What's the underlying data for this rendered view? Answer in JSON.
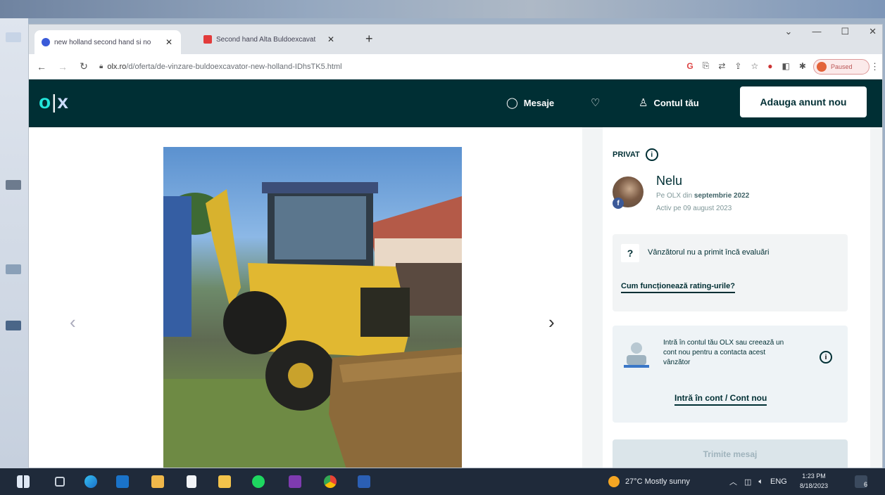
{
  "browser": {
    "tabs": [
      {
        "title": "new holland second hand si no",
        "favicon_color": "#3a5bd9",
        "active": true
      },
      {
        "title": "Second hand Alta Buldoexcavat",
        "favicon_color": "#e23b3b",
        "active": false
      }
    ],
    "new_tab": "+",
    "url_host": "olx.ro",
    "url_path": "/d/oferta/de-vinzare-buldoexcavator-new-holland-IDhsTK5.html",
    "profile_status": "Paused",
    "window_controls": [
      "⌄",
      "—",
      "☐",
      "✕"
    ]
  },
  "header": {
    "logo": {
      "o": "o",
      "bar": "|",
      "x": "x"
    },
    "messages_label": "Mesaje",
    "account_label": "Contul tău",
    "post_button": "Adauga anunt nou"
  },
  "gallery": {
    "prev_arrow": "‹",
    "next_arrow": "›"
  },
  "seller": {
    "type_label": "PRIVAT",
    "info_glyph": "i",
    "name": "Nelu",
    "since_prefix": "Pe OLX din ",
    "since_value": "septembrie 2022",
    "active": "Activ pe 09 august 2023",
    "rating_icon": "?",
    "rating_text": "Vânzătorul nu a primit încă evaluări",
    "rating_link": "Cum funcționează rating-urile?",
    "login_text": "Intră în contul tău OLX sau creează un cont nou pentru a contacta acest vânzător",
    "login_link": "Intră în cont / Cont nou",
    "send_button": "Trimite mesaj",
    "fb_badge": "f"
  },
  "taskbar": {
    "weather": "27°C  Mostly sunny",
    "language": "ENG",
    "time": "1:23 PM",
    "date": "8/18/2023",
    "notifications": "6"
  },
  "colors": {
    "olx_dark": "#002f34",
    "olx_teal": "#23e5db",
    "taskbar": "#1f2a3a"
  }
}
